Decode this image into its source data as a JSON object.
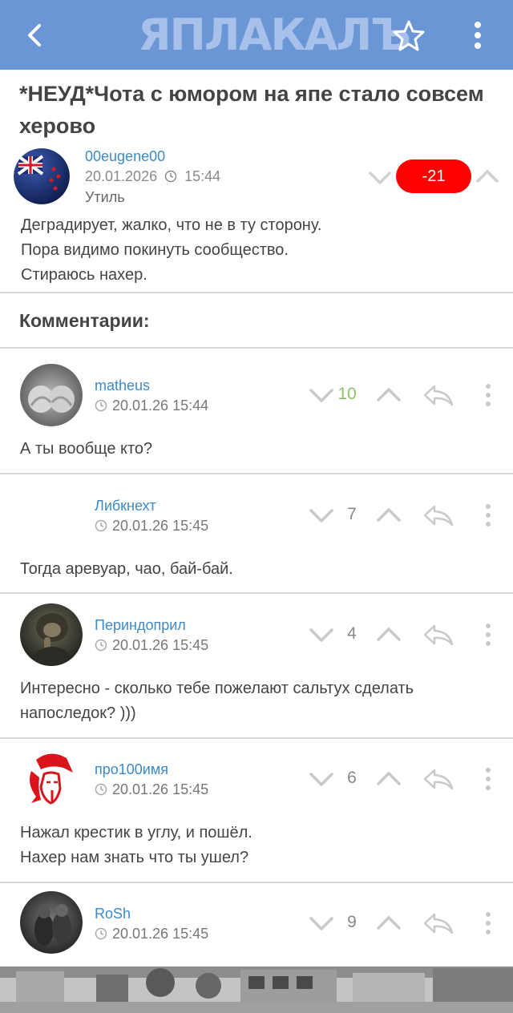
{
  "header": {
    "logo_text": "ЯПЛАКАЛЪ",
    "back_icon": "chevron-left-icon",
    "favorite_icon": "star-icon",
    "menu_icon": "kebab-icon"
  },
  "colors": {
    "topbar": "#6b96d6",
    "link": "#3d8ac6",
    "negative_badge": "#ff0000",
    "positive_rating": "#8ac46a"
  },
  "post": {
    "title": "*НЕУД*Чота с юмором на япе стало совсем херово",
    "author": "00eugene00",
    "date": "20.01.2026",
    "time": "15:44",
    "category": "Утиль",
    "rating": "-21",
    "body": [
      "Деградирует, жалко, что не в ту сторону.",
      "Пора видимо покинуть сообщество.",
      "Стираюсь нахер."
    ]
  },
  "comments_header": "Комментарии:",
  "comments": [
    {
      "author": "matheus",
      "datetime": "20.01.26 15:44",
      "rating": "10",
      "body": [
        "А ты вообще кто?"
      ]
    },
    {
      "author": "Либкнехт",
      "datetime": "20.01.26 15:45",
      "rating": "7",
      "body": [
        "Тогда аревуар, чао, бай-бай."
      ]
    },
    {
      "author": "Периндоприл",
      "datetime": "20.01.26 15:45",
      "rating": "4",
      "body": [
        "Интересно - сколько тебе пожелают сальтух сделать",
        "напоследок? )))"
      ]
    },
    {
      "author": "про100имя",
      "datetime": "20.01.26 15:45",
      "rating": "6",
      "body": [
        "Нажал крестик в углу, и пошёл.",
        "Нахер нам знать что ты ушел?"
      ]
    },
    {
      "author": "RoSh",
      "datetime": "20.01.26 15:45",
      "rating": "9",
      "body": []
    }
  ]
}
